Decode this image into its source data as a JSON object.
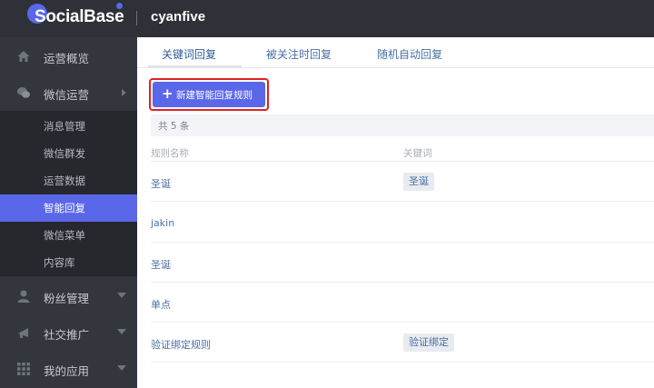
{
  "header": {
    "logo_text": "SocialBase",
    "org_name": "cyanfive"
  },
  "sidebar": {
    "items": [
      {
        "label": "运营概览",
        "icon": "home-icon"
      },
      {
        "label": "微信运营",
        "icon": "wechat-icon"
      },
      {
        "label": "粉丝管理",
        "icon": "user-icon"
      },
      {
        "label": "社交推广",
        "icon": "megaphone-icon"
      },
      {
        "label": "我的应用",
        "icon": "grid-icon"
      }
    ],
    "sub_items": [
      {
        "label": "消息管理"
      },
      {
        "label": "微信群发"
      },
      {
        "label": "运营数据"
      },
      {
        "label": "智能回复"
      },
      {
        "label": "微信菜单"
      },
      {
        "label": "内容库"
      }
    ]
  },
  "tabs": [
    {
      "label": "关键词回复"
    },
    {
      "label": "被关注时回复"
    },
    {
      "label": "随机自动回复"
    }
  ],
  "toolbar": {
    "new_rule_label": "新建智能回复规则"
  },
  "table": {
    "count_text": "共 5 条",
    "headers": {
      "name": "规则名称",
      "keyword": "关键词"
    },
    "rows": [
      {
        "name": "圣诞",
        "keyword": "圣诞"
      },
      {
        "name": "jakin",
        "keyword": ""
      },
      {
        "name": "圣诞",
        "keyword": ""
      },
      {
        "name": "单点",
        "keyword": ""
      },
      {
        "name": "验证绑定规则",
        "keyword": "验证绑定"
      }
    ]
  },
  "colors": {
    "accent": "#5a67e8",
    "topbar": "#2e3138",
    "sidebar": "#33363d",
    "submenu": "#25282d",
    "highlight_frame": "#e02020"
  }
}
